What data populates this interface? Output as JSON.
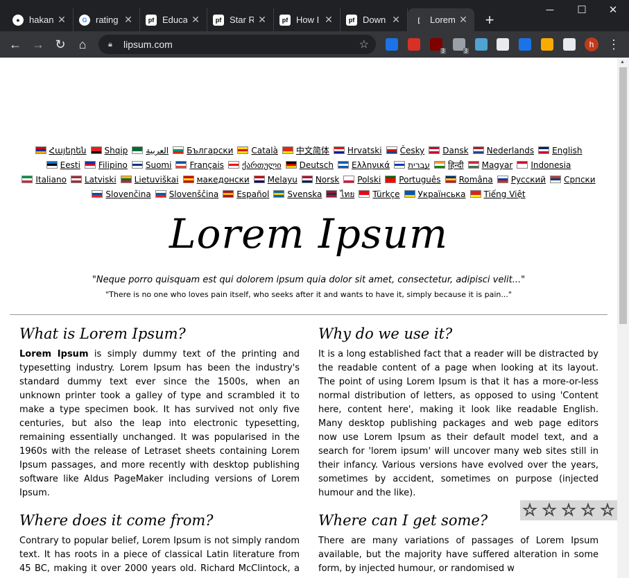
{
  "browser": {
    "tabs": [
      {
        "label": "hakan",
        "icon": "github-icon",
        "color": "#ffffff"
      },
      {
        "label": "rating",
        "icon": "google-icon",
        "color": "#ffffff"
      },
      {
        "label": "Educa",
        "icon": "pf-icon",
        "color": "#ffffff"
      },
      {
        "label": "Star R",
        "icon": "pf-icon",
        "color": "#ffffff"
      },
      {
        "label": "How I",
        "icon": "pf-icon",
        "color": "#ffffff"
      },
      {
        "label": "Down",
        "icon": "pf-icon",
        "color": "#ffffff"
      },
      {
        "label": "Lorem",
        "icon": "loading-icon",
        "color": "#35363a"
      }
    ],
    "url": "lipsum.com",
    "avatar_letter": "h",
    "extensions": [
      {
        "icon": "arrow-extension-icon",
        "color": "#1a73e8",
        "badge": ""
      },
      {
        "icon": "bookmark-extension-icon",
        "color": "#d93025",
        "badge": ""
      },
      {
        "icon": "ublock-icon",
        "color": "#800000",
        "badge": "3"
      },
      {
        "icon": "puzzle-gear-extension-icon",
        "color": "#9aa0a6",
        "badge": "3"
      },
      {
        "icon": "owl-extension-icon",
        "color": "#4fa3d1",
        "badge": ""
      },
      {
        "icon": "compass-extension-icon",
        "color": "#e8eaed",
        "badge": ""
      },
      {
        "icon": "window-extension-icon",
        "color": "#1a73e8",
        "badge": ""
      },
      {
        "icon": "colorful-extension-icon",
        "color": "#f9ab00",
        "badge": ""
      },
      {
        "icon": "extensions-puzzle-icon",
        "color": "#e8eaed",
        "badge": ""
      }
    ]
  },
  "languages": [
    [
      {
        "name": "Հայերեն",
        "flag": [
          "#d90012",
          "#0033a0",
          "#f2a800"
        ]
      },
      {
        "name": "Shqip",
        "flag": [
          "#e41e20",
          "#e41e20",
          "#000000"
        ]
      },
      {
        "name": "العربية",
        "flag": [
          "#006c35",
          "#006c35",
          "#ffffff"
        ]
      },
      {
        "name": "Български",
        "flag": [
          "#ffffff",
          "#00966e",
          "#d62612"
        ]
      },
      {
        "name": "Català",
        "flag": [
          "#fcdd09",
          "#da121a",
          "#fcdd09"
        ]
      },
      {
        "name": "中文简体",
        "flag": [
          "#de2910",
          "#de2910",
          "#ffde00"
        ]
      },
      {
        "name": "Hrvatski",
        "flag": [
          "#ff0000",
          "#ffffff",
          "#171796"
        ]
      },
      {
        "name": "Česky",
        "flag": [
          "#ffffff",
          "#d7141a",
          "#11457e"
        ]
      },
      {
        "name": "Dansk",
        "flag": [
          "#c60c30",
          "#ffffff",
          "#c60c30"
        ]
      },
      {
        "name": "Nederlands",
        "flag": [
          "#ae1c28",
          "#ffffff",
          "#21468b"
        ]
      },
      {
        "name": "English",
        "flag": [
          "#012169",
          "#ffffff",
          "#c8102e"
        ]
      }
    ],
    [
      {
        "name": "Eesti",
        "flag": [
          "#0072ce",
          "#000000",
          "#ffffff"
        ]
      },
      {
        "name": "Filipino",
        "flag": [
          "#0038a8",
          "#ce1126",
          "#ffffff"
        ]
      },
      {
        "name": "Suomi",
        "flag": [
          "#ffffff",
          "#003580",
          "#ffffff"
        ]
      },
      {
        "name": "Français",
        "flag": [
          "#0055a4",
          "#ffffff",
          "#ef4135"
        ]
      },
      {
        "name": "ქართული",
        "flag": [
          "#ffffff",
          "#ff0000",
          "#ffffff"
        ]
      },
      {
        "name": "Deutsch",
        "flag": [
          "#000000",
          "#dd0000",
          "#ffce00"
        ]
      },
      {
        "name": "Ελληνικά",
        "flag": [
          "#0d5eaf",
          "#ffffff",
          "#0d5eaf"
        ]
      },
      {
        "name": "עברית",
        "flag": [
          "#ffffff",
          "#0038b8",
          "#ffffff"
        ]
      },
      {
        "name": "हिन्दी",
        "flag": [
          "#ff9933",
          "#ffffff",
          "#138808"
        ]
      },
      {
        "name": "Magyar",
        "flag": [
          "#ce2939",
          "#ffffff",
          "#477050"
        ]
      },
      {
        "name": "Indonesia",
        "flag": [
          "#ce1126",
          "#ffffff",
          "#ffffff"
        ]
      }
    ],
    [
      {
        "name": "Italiano",
        "flag": [
          "#009246",
          "#ffffff",
          "#ce2b37"
        ]
      },
      {
        "name": "Latviski",
        "flag": [
          "#9e3039",
          "#ffffff",
          "#9e3039"
        ]
      },
      {
        "name": "Lietuviškai",
        "flag": [
          "#fdb913",
          "#006a44",
          "#c1272d"
        ]
      },
      {
        "name": "македонски",
        "flag": [
          "#d20000",
          "#ffe600",
          "#d20000"
        ]
      },
      {
        "name": "Melayu",
        "flag": [
          "#cc0001",
          "#ffffff",
          "#010066"
        ]
      },
      {
        "name": "Norsk",
        "flag": [
          "#ba0c2f",
          "#ffffff",
          "#00205b"
        ]
      },
      {
        "name": "Polski",
        "flag": [
          "#ffffff",
          "#ffffff",
          "#dc143c"
        ]
      },
      {
        "name": "Português",
        "flag": [
          "#006600",
          "#ff0000",
          "#ff0000"
        ]
      },
      {
        "name": "Româna",
        "flag": [
          "#002b7f",
          "#fcd116",
          "#ce1126"
        ]
      },
      {
        "name": "Pусский",
        "flag": [
          "#ffffff",
          "#0039a6",
          "#d52b1e"
        ]
      },
      {
        "name": "Српски",
        "flag": [
          "#c6363c",
          "#0c4076",
          "#ffffff"
        ]
      }
    ],
    [
      {
        "name": "Slovenčina",
        "flag": [
          "#ffffff",
          "#0b4ea2",
          "#ee1c25"
        ]
      },
      {
        "name": "Slovenščina",
        "flag": [
          "#ffffff",
          "#005da4",
          "#ed1c24"
        ]
      },
      {
        "name": "Español",
        "flag": [
          "#aa151b",
          "#f1bf00",
          "#aa151b"
        ]
      },
      {
        "name": "Svenska",
        "flag": [
          "#006aa7",
          "#fecc00",
          "#006aa7"
        ]
      },
      {
        "name": "ไทย",
        "flag": [
          "#a51931",
          "#2d2a4a",
          "#a51931"
        ]
      },
      {
        "name": "Türkçe",
        "flag": [
          "#e30a17",
          "#e30a17",
          "#ffffff"
        ]
      },
      {
        "name": "Українська",
        "flag": [
          "#0057b7",
          "#0057b7",
          "#ffd700"
        ]
      },
      {
        "name": "Tiếng Việt",
        "flag": [
          "#da251d",
          "#da251d",
          "#ffff00"
        ]
      }
    ]
  ],
  "page": {
    "title": "Lorem Ipsum",
    "quote_latin": "\"Neque porro quisquam est qui dolorem ipsum quia dolor sit amet, consectetur, adipisci velit...\"",
    "quote_english": "\"There is no one who loves pain itself, who seeks after it and wants to have it, simply because it is pain...\"",
    "sections": {
      "what": {
        "heading": "What is Lorem Ipsum?",
        "lead": "Lorem Ipsum",
        "body": " is simply dummy text of the printing and typesetting industry. Lorem Ipsum has been the industry's standard dummy text ever since the 1500s, when an unknown printer took a galley of type and scrambled it to make a type specimen book. It has survived not only five centuries, but also the leap into electronic typesetting, remaining essentially unchanged. It was popularised in the 1960s with the release of Letraset sheets containing Lorem Ipsum passages, and more recently with desktop publishing software like Aldus PageMaker including versions of Lorem Ipsum."
      },
      "why": {
        "heading": "Why do we use it?",
        "body": "It is a long established fact that a reader will be distracted by the readable content of a page when looking at its layout. The point of using Lorem Ipsum is that it has a more-or-less normal distribution of letters, as opposed to using 'Content here, content here', making it look like readable English. Many desktop publishing packages and web page editors now use Lorem Ipsum as their default model text, and a search for 'lorem ipsum' will uncover many web sites still in their infancy. Various versions have evolved over the years, sometimes by accident, sometimes on purpose (injected humour and the like)."
      },
      "where_from": {
        "heading": "Where does it come from?",
        "body": "Contrary to popular belief, Lorem Ipsum is not simply random text. It has roots in a piece of classical Latin literature from 45 BC, making it over 2000 years old. Richard McClintock, a Latin"
      },
      "where_get": {
        "heading": "Where can I get some?",
        "body": "There are many variations of passages of Lorem Ipsum available, but the majority have suffered alteration in some form, by injected humour, or randomised w"
      }
    },
    "rating": {
      "stars_filled": 0,
      "stars_total": 5,
      "symbol": "☆"
    }
  }
}
